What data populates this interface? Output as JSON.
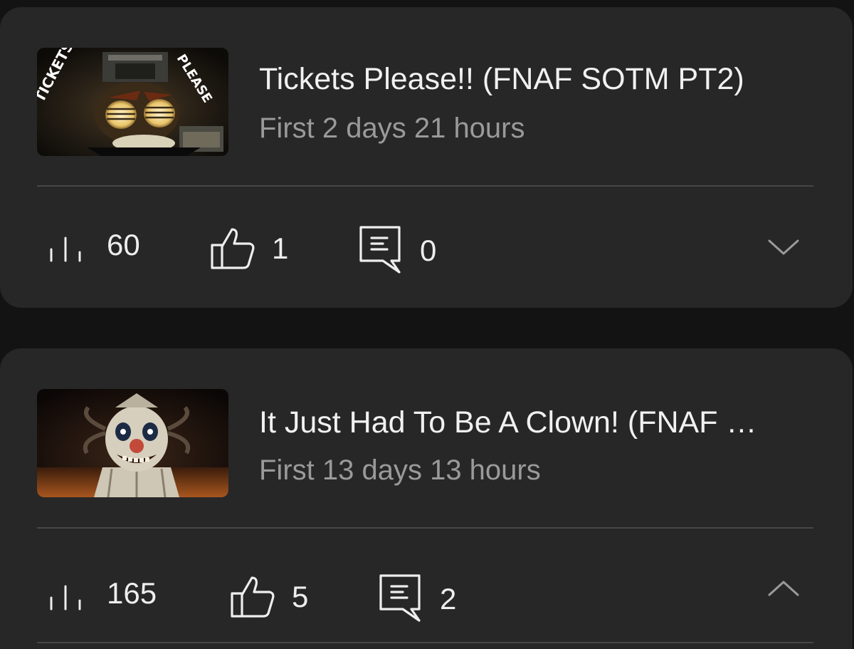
{
  "videos": [
    {
      "title": "Tickets Please!! (FNAF SOTM PT2)",
      "subtitle": "First 2 days 21 hours",
      "views": "60",
      "likes": "1",
      "comments": "0",
      "thumbnail_text": [
        "TICKETS",
        "PLEASE"
      ],
      "expanded": false
    },
    {
      "title": "It Just Had To Be A Clown! (FNAF …",
      "subtitle": "First 13 days 13 hours",
      "views": "165",
      "likes": "5",
      "comments": "2",
      "expanded": true
    }
  ],
  "icons": {
    "views": "bar-chart-icon",
    "likes": "thumbs-up-icon",
    "comments": "comment-icon",
    "collapsed": "chevron-down-icon",
    "expanded": "chevron-up-icon"
  },
  "colors": {
    "background": "#131313",
    "card": "#272727",
    "title_text": "#f1f1f1",
    "secondary_text": "#9a9a9a",
    "divider": "#474747"
  }
}
